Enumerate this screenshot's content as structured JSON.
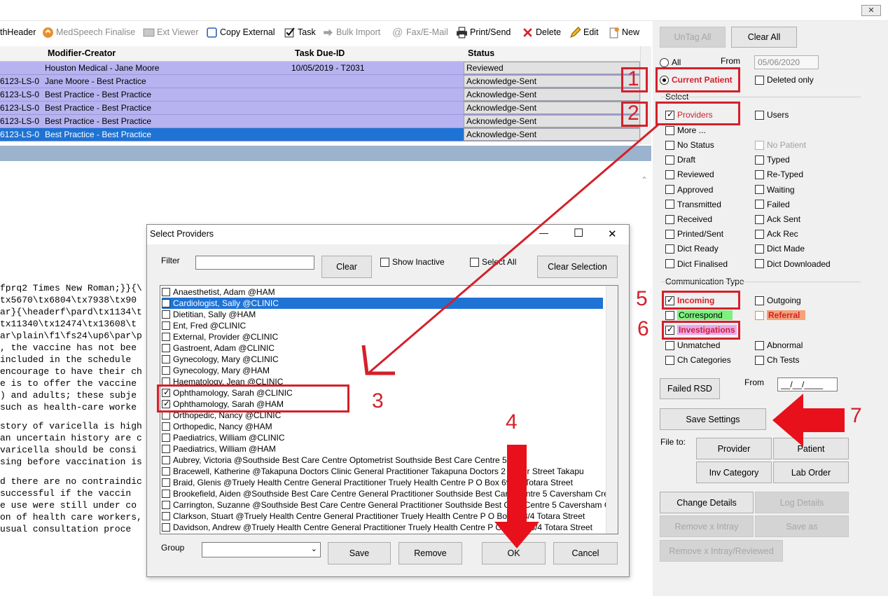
{
  "titlebar": {
    "close_label": "✕"
  },
  "toolbar": {
    "items": [
      {
        "label": "thHeader",
        "icon": "none",
        "disabled": false
      },
      {
        "label": "MedSpeech Finalise",
        "icon": "medspeech-icon",
        "disabled": true
      },
      {
        "label": "Ext Viewer",
        "icon": "ext-viewer-icon",
        "disabled": true
      },
      {
        "label": "Copy External",
        "icon": "copy-icon",
        "disabled": false
      },
      {
        "label": "Task",
        "icon": "task-check-icon",
        "disabled": false
      },
      {
        "label": "Bulk Import",
        "icon": "import-icon",
        "disabled": true
      },
      {
        "label": "Fax/E-Mail",
        "icon": "at-icon",
        "disabled": true
      },
      {
        "label": "Print/Send",
        "icon": "printer-icon",
        "disabled": false
      },
      {
        "label": "Delete",
        "icon": "delete-x-icon",
        "disabled": false
      },
      {
        "label": "Edit",
        "icon": "pencil-icon",
        "disabled": false
      },
      {
        "label": "New",
        "icon": "new-doc-icon",
        "disabled": false
      }
    ]
  },
  "grid": {
    "columns": [
      "Modifier-Creator",
      "Task Due-ID",
      "Status"
    ],
    "rows": [
      {
        "id": "",
        "modifier": "Houston Medical - Jane Moore",
        "task": "10/05/2019 - T2031",
        "status": "Reviewed"
      },
      {
        "id": "6123-LS-0",
        "modifier": "Jane Moore - Best Practice",
        "task": "",
        "status": "Acknowledge-Sent"
      },
      {
        "id": "6123-LS-0",
        "modifier": "Best Practice - Best Practice",
        "task": "",
        "status": "Acknowledge-Sent"
      },
      {
        "id": "6123-LS-0",
        "modifier": "Best Practice - Best Practice",
        "task": "",
        "status": "Acknowledge-Sent"
      },
      {
        "id": "6123-LS-0",
        "modifier": "Best Practice - Best Practice",
        "task": "",
        "status": "Acknowledge-Sent"
      },
      {
        "id": "6123-LS-0",
        "modifier": "Best Practice - Best Practice",
        "task": "",
        "status": "Acknowledge-Sent"
      }
    ]
  },
  "rtf_lines": [
    {
      "text": "fprq2 Times New Roman;}}{\\"
    },
    {
      "text": "tx5670\\tx6804\\tx7938\\tx90"
    },
    {
      "text": "ar}{\\headerf\\pard\\tx1134\\t"
    },
    {
      "text": "tx11340\\tx12474\\tx13608\\t"
    },
    {
      "text": "ar\\plain\\f1\\fs24\\up6\\par\\p"
    },
    {
      "text": ", the vaccine has not bee"
    },
    {
      "text": "included in the schedule"
    },
    {
      "text": "encourage to have their ch"
    },
    {
      "text": "e is to offer the vaccine"
    },
    {
      "text": ") and adults; these subje"
    },
    {
      "text": "such as health-care worke"
    },
    {
      "text": "story of varicella is high"
    },
    {
      "text": "an uncertain history are c"
    },
    {
      "text": "varicella should be consi"
    },
    {
      "text": "sing before vaccination is"
    },
    {
      "text": "d there are no contraindic"
    },
    {
      "text": "successful if the vaccin"
    },
    {
      "text": "e use were still under co"
    },
    {
      "text": "on of health care workers,"
    },
    {
      "text": "usual consultation proce"
    }
  ],
  "right": {
    "untag_all": "UnTag All",
    "clear_all": "Clear All",
    "all_label": "All",
    "from_label": "From",
    "from_date": "05/06/2020",
    "current_patient": "Current Patient",
    "deleted_only": "Deleted only",
    "select_heading": "Select",
    "providers": "Providers",
    "users": "Users",
    "more": "More ...",
    "status_left": [
      "No Status",
      "Draft",
      "Reviewed",
      "Approved",
      "Transmitted",
      "Received",
      "Printed/Sent",
      "Dict Ready",
      "Dict Finalised"
    ],
    "status_right": [
      "No Patient",
      "Typed",
      "Re-Typed",
      "Waiting",
      "Failed",
      "Ack Sent",
      "Ack Rec",
      "Dict Made",
      "Dict Downloaded"
    ],
    "comm_heading": "Communication Type",
    "incoming": "Incoming",
    "outgoing": "Outgoing",
    "correspond": "Correspond",
    "referral": "Referral",
    "investigations": "Investigations",
    "unmatched": "Unmatched",
    "abnormal": "Abnormal",
    "ch_categories": "Ch Categories",
    "ch_tests": "Ch Tests",
    "failed_rsd": "Failed RSD",
    "from2_label": "From",
    "from2_value": "__/__/____",
    "save_settings": "Save Settings",
    "file_to": "File to:",
    "provider": "Provider",
    "patient": "Patient",
    "inv_category": "Inv Category",
    "lab_order": "Lab Order",
    "change_details": "Change Details",
    "log_details": "Log Details",
    "remove_intray": "Remove x Intray",
    "save_as": "Save as",
    "remove_intray_reviewed": "Remove x Intray/Reviewed"
  },
  "annotations": [
    "1",
    "2",
    "3",
    "4",
    "5",
    "6",
    "7"
  ],
  "dialog": {
    "title": "Select Providers",
    "minimize": "—",
    "maximize": "☐",
    "close": "✕",
    "filter_label": "Filter",
    "filter_value": "",
    "clear": "Clear",
    "show_inactive": "Show Inactive",
    "select_all": "Select All",
    "clear_selection": "Clear Selection",
    "providers": [
      {
        "name": "Anaesthetist, Adam @HAM",
        "checked": false,
        "selected": false
      },
      {
        "name": "Cardiologist, Sally @CLINIC",
        "checked": false,
        "selected": true
      },
      {
        "name": "Dietitian, Sally @HAM",
        "checked": false,
        "selected": false
      },
      {
        "name": "Ent, Fred @CLINIC",
        "checked": false,
        "selected": false
      },
      {
        "name": "External, Provider @CLINIC",
        "checked": false,
        "selected": false
      },
      {
        "name": "Gastroent, Adam @CLINIC",
        "checked": false,
        "selected": false
      },
      {
        "name": "Gynecology, Mary @CLINIC",
        "checked": false,
        "selected": false
      },
      {
        "name": "Gynecology, Mary @HAM",
        "checked": false,
        "selected": false
      },
      {
        "name": "Haematology, Jean @CLINIC",
        "checked": false,
        "selected": false
      },
      {
        "name": "Ophthamology, Sarah @CLINIC",
        "checked": true,
        "selected": false
      },
      {
        "name": "Ophthamology, Sarah @HAM",
        "checked": true,
        "selected": false
      },
      {
        "name": "Orthopedic, Nancy @CLINIC",
        "checked": false,
        "selected": false
      },
      {
        "name": "Orthopedic, Nancy @HAM",
        "checked": false,
        "selected": false
      },
      {
        "name": "Paediatrics, William @CLINIC",
        "checked": false,
        "selected": false
      },
      {
        "name": "Paediatrics, William @HAM",
        "checked": false,
        "selected": false
      },
      {
        "name": "Aubrey, Victoria @Southside Best Care Centre Optometrist Southside Best Care Centre 5",
        "checked": false,
        "selected": false
      },
      {
        "name": "Bracewell, Katherine @Takapuna Doctors Clinic General Practitioner Takapuna Doctors 2 Baker Street Takapu",
        "checked": false,
        "selected": false
      },
      {
        "name": "Braid, Glenis @Truely Health Centre General Practitioner Truely Health Centre P O Box 698/4 Totara Street",
        "checked": false,
        "selected": false
      },
      {
        "name": "Brookefield, Aiden @Southside Best Care Centre General Practitioner Southside Best Care Centre 5 Caversham Cres",
        "checked": false,
        "selected": false
      },
      {
        "name": "Carrington, Suzanne @Southside Best Care Centre General Practitioner Southside Best Care Centre 5 Caversham C",
        "checked": false,
        "selected": false
      },
      {
        "name": "Clarkson, Stuart @Truely Health Centre General Practitioner Truely Health Centre P O Box 698/4 Totara Street",
        "checked": false,
        "selected": false
      },
      {
        "name": "Davidson, Andrew @Truely Health Centre General Practitioner Truely Health Centre P O Box 698/4 Totara Street",
        "checked": false,
        "selected": false
      }
    ],
    "group_label": "Group",
    "group_value": "",
    "save": "Save",
    "remove": "Remove",
    "ok": "OK",
    "cancel": "Cancel"
  },
  "colors": {
    "accent_red": "#d4202a",
    "row_purple": "#b7b3f0",
    "row_selected": "#1f73d4"
  }
}
